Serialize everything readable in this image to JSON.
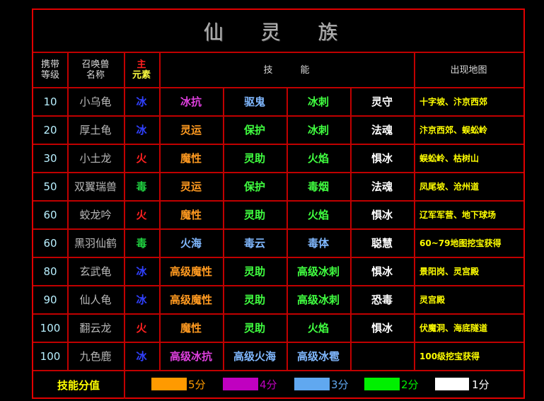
{
  "title": "仙 灵 族",
  "headers": {
    "level_l1": "携带",
    "level_l2": "等级",
    "name_l1": "召唤兽",
    "name_l2": "名称",
    "elem_l1": "主",
    "elem_l2": "元素",
    "skills": "技　　　能",
    "map": "出现地图"
  },
  "rows": [
    {
      "level": "10",
      "name": "小乌龟",
      "elem": "冰",
      "elemColor": "#3040ff",
      "skills": [
        {
          "t": "冰抗",
          "c": "#e040e0"
        },
        {
          "t": "驱鬼",
          "c": "#80b8ff"
        },
        {
          "t": "冰刺",
          "c": "#40ff40"
        },
        {
          "t": "灵守",
          "c": "#ffffff"
        }
      ],
      "map": "十字坡、汴京西郊"
    },
    {
      "level": "20",
      "name": "厚土龟",
      "elem": "冰",
      "elemColor": "#3040ff",
      "skills": [
        {
          "t": "灵运",
          "c": "#ff9a20"
        },
        {
          "t": "保护",
          "c": "#40ff40"
        },
        {
          "t": "冰刺",
          "c": "#40ff40"
        },
        {
          "t": "法魂",
          "c": "#ffffff"
        }
      ],
      "map": "汴京西郊、蜈蚣岭"
    },
    {
      "level": "30",
      "name": "小土龙",
      "elem": "火",
      "elemColor": "#ff2020",
      "skills": [
        {
          "t": "魔性",
          "c": "#ff9a20"
        },
        {
          "t": "灵助",
          "c": "#40ff40"
        },
        {
          "t": "火焰",
          "c": "#40ff40"
        },
        {
          "t": "惧冰",
          "c": "#ffffff"
        }
      ],
      "map": "蜈蚣岭、枯树山"
    },
    {
      "level": "50",
      "name": "双翼瑞兽",
      "elem": "毒",
      "elemColor": "#20d040",
      "skills": [
        {
          "t": "灵运",
          "c": "#ff9a20"
        },
        {
          "t": "保护",
          "c": "#40ff40"
        },
        {
          "t": "毒烟",
          "c": "#40ff40"
        },
        {
          "t": "法魂",
          "c": "#ffffff"
        }
      ],
      "map": "凤尾坡、沧州道"
    },
    {
      "level": "60",
      "name": "蛟龙吟",
      "elem": "火",
      "elemColor": "#ff2020",
      "skills": [
        {
          "t": "魔性",
          "c": "#ff9a20"
        },
        {
          "t": "灵助",
          "c": "#40ff40"
        },
        {
          "t": "火焰",
          "c": "#40ff40"
        },
        {
          "t": "惧冰",
          "c": "#ffffff"
        }
      ],
      "map": "辽军军营、地下球场"
    },
    {
      "level": "60",
      "name": "黑羽仙鹤",
      "elem": "毒",
      "elemColor": "#20d040",
      "skills": [
        {
          "t": "火海",
          "c": "#80b8ff"
        },
        {
          "t": "毒云",
          "c": "#80b8ff"
        },
        {
          "t": "毒体",
          "c": "#80b8ff"
        },
        {
          "t": "聪慧",
          "c": "#ffffff"
        }
      ],
      "map": "60~79地图挖宝获得"
    },
    {
      "level": "80",
      "name": "玄武龟",
      "elem": "冰",
      "elemColor": "#3040ff",
      "skills": [
        {
          "t": "高级魔性",
          "c": "#ff9a20"
        },
        {
          "t": "灵助",
          "c": "#40ff40"
        },
        {
          "t": "高级冰刺",
          "c": "#40ff40"
        },
        {
          "t": "惧冰",
          "c": "#ffffff"
        }
      ],
      "map": "景阳岗、灵宫殿"
    },
    {
      "level": "90",
      "name": "仙人龟",
      "elem": "冰",
      "elemColor": "#3040ff",
      "skills": [
        {
          "t": "高级魔性",
          "c": "#ff9a20"
        },
        {
          "t": "灵助",
          "c": "#40ff40"
        },
        {
          "t": "高级冰刺",
          "c": "#40ff40"
        },
        {
          "t": "恐毒",
          "c": "#ffffff"
        }
      ],
      "map": "灵宫殿"
    },
    {
      "level": "100",
      "name": "翻云龙",
      "elem": "火",
      "elemColor": "#ff2020",
      "skills": [
        {
          "t": "魔性",
          "c": "#ff9a20"
        },
        {
          "t": "灵助",
          "c": "#40ff40"
        },
        {
          "t": "火焰",
          "c": "#40ff40"
        },
        {
          "t": "惧冰",
          "c": "#ffffff"
        }
      ],
      "map": "伏魔洞、海底隧道"
    },
    {
      "level": "100",
      "name": "九色鹿",
      "elem": "冰",
      "elemColor": "#3040ff",
      "skills": [
        {
          "t": "高级冰抗",
          "c": "#e040e0"
        },
        {
          "t": "高级火海",
          "c": "#80b8ff"
        },
        {
          "t": "高级冰雹",
          "c": "#80b8ff"
        },
        {
          "t": "",
          "c": "#ffffff"
        }
      ],
      "map": "100级挖宝获得"
    }
  ],
  "legend": {
    "label": "技能分值",
    "items": [
      {
        "color": "#ff9a00",
        "text": "5分"
      },
      {
        "color": "#c000c0",
        "text": "4分"
      },
      {
        "color": "#60a8f0",
        "text": "3分"
      },
      {
        "color": "#00f000",
        "text": "2分"
      },
      {
        "color": "#ffffff",
        "text": "1分"
      }
    ]
  }
}
